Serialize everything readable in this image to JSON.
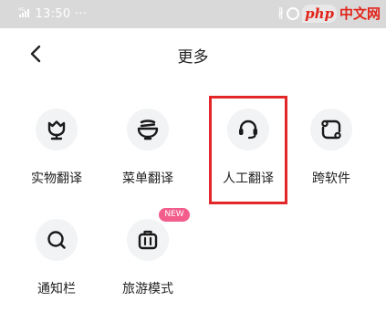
{
  "status": {
    "time": "13:50",
    "dots": "···",
    "network": "4G"
  },
  "watermark": {
    "php": "php",
    "cn": "中文网"
  },
  "header": {
    "title": "更多"
  },
  "items": [
    {
      "label": "实物翻译",
      "icon": "tulip-icon"
    },
    {
      "label": "菜单翻译",
      "icon": "bowl-icon"
    },
    {
      "label": "人工翻译",
      "icon": "headset-icon"
    },
    {
      "label": "跨软件",
      "icon": "cross-app-icon"
    },
    {
      "label": "通知栏",
      "icon": "search-icon"
    },
    {
      "label": "旅游模式",
      "icon": "luggage-icon"
    }
  ],
  "badge": {
    "text": "NEW"
  },
  "colors": {
    "highlight": "#e32628",
    "badge": "#f25d8c",
    "icon_bg": "#f2f3f5"
  }
}
